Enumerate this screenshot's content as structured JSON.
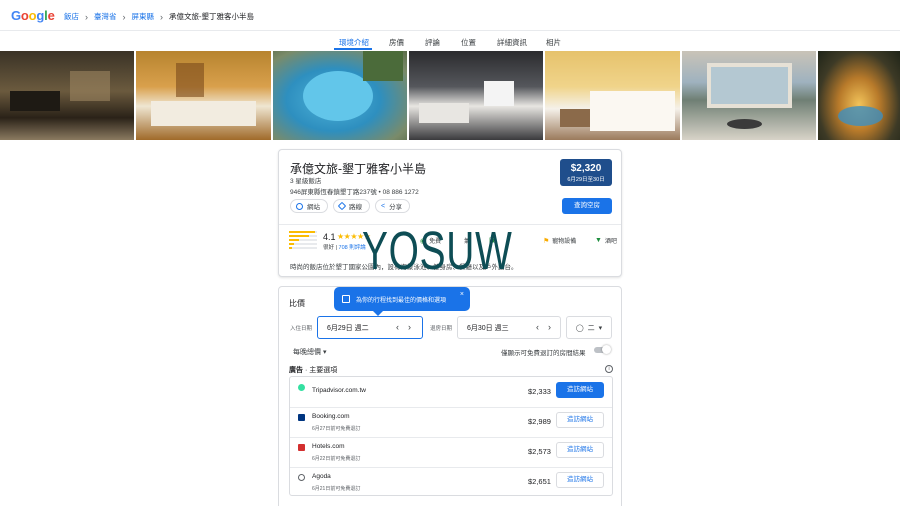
{
  "header": {
    "logo": [
      "G",
      "o",
      "o",
      "g",
      "l",
      "e"
    ],
    "logo_colors": [
      "#4285f4",
      "#ea4335",
      "#fbbc04",
      "#4285f4",
      "#34a853",
      "#ea4335"
    ],
    "breadcrumbs": [
      "飯店",
      "臺灣省",
      "屏東縣",
      "承億文旅-墾丁雅客小半島"
    ],
    "sep": "›"
  },
  "tabs": [
    "環境介紹",
    "房價",
    "評論",
    "位置",
    "詳細資訊",
    "相片"
  ],
  "hotel": {
    "name": "承億文旅-墾丁雅客小半島",
    "class": "3 星級飯店",
    "address": "946屏東縣恆春鎮墾丁路237號 • 08 886 1272",
    "chips": [
      "網站",
      "路線",
      "分享"
    ],
    "price": "$2,320",
    "price_dates": "6月29日至30日",
    "availability_button": "查詢空房",
    "rating": "4.1",
    "stars": "★★★★★",
    "rating_label": "很好",
    "reviews": "708 則評論",
    "amenities": [
      "免費",
      "氣",
      "泳池",
      "海灘",
      "寵物",
      "游泳",
      "酒吧"
    ],
    "amenity_extra": "寵物設備",
    "description": "時尚的飯店位於墾丁國家公園內，設有海景泳池、健身房、餐廳以及戶外露台。"
  },
  "watermark": "YOSUW",
  "prices": {
    "title": "比價",
    "tooltip": "為你的行程找到最佳的價格和選項",
    "tooltip_close": "×",
    "checkin_label": "入住日期",
    "checkin": "6月29日 週二",
    "checkout_label": "退房日期",
    "checkout": "6月30日 週三",
    "guests": "二",
    "per_night": "每晚總價 ▾",
    "free_cancel_label": "僅顯示可免費退訂的房間結果",
    "ads_label": "廣告",
    "ads_sub": " · 主要選項",
    "listings": [
      {
        "name": "Tripadvisor.com.tw",
        "note": "",
        "price": "$2,333",
        "button": "造訪網站",
        "color": "#34e0a1"
      },
      {
        "name": "Booking.com",
        "note": "6月27日前可免費退訂",
        "price": "$2,989",
        "button": "造訪網站",
        "color": "#003580"
      },
      {
        "name": "Hotels.com",
        "note": "6月22日前可免費退訂",
        "price": "$2,573",
        "button": "造訪網站",
        "color": "#d32f2f"
      },
      {
        "name": "Agoda",
        "note": "6月21日前可免費退訂",
        "price": "$2,651",
        "button": "造訪網站",
        "color": "#5f6368"
      }
    ]
  }
}
